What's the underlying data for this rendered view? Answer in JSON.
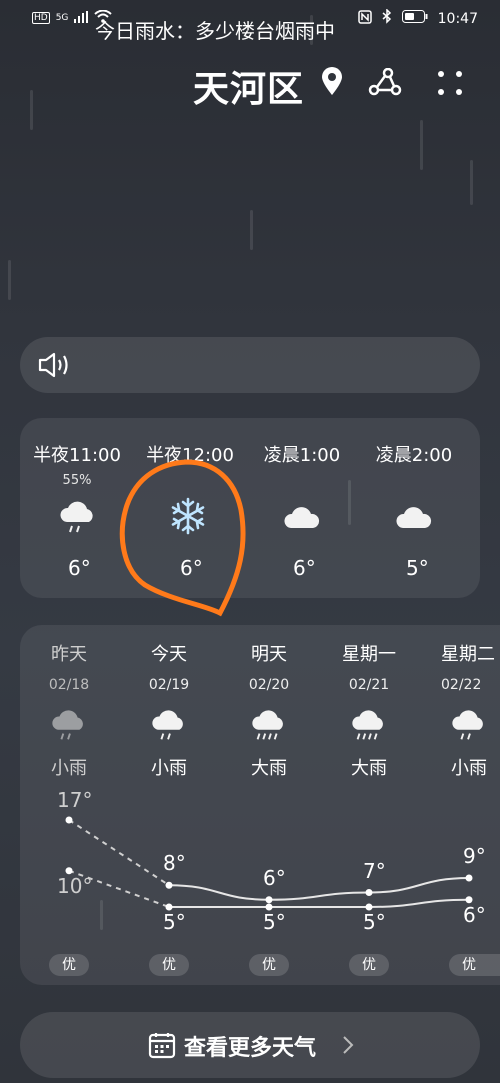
{
  "status_bar": {
    "left_badges": [
      "HD",
      "5G"
    ],
    "time": "10:47",
    "right_icons": [
      "nfc-icon",
      "bluetooth-icon",
      "battery-icon"
    ]
  },
  "header": {
    "city": "天河区",
    "icons": [
      "location-pin-icon",
      "share-icon",
      "more-icon"
    ]
  },
  "notice": {
    "icon": "speaker-icon",
    "text": "今日雨水：多少楼台烟雨中"
  },
  "hourly": [
    {
      "time": "半夜11:00",
      "precip": "55%",
      "icon": "rain-cloud-icon",
      "temp": "6°"
    },
    {
      "time": "半夜12:00",
      "precip": "",
      "icon": "snowflake-icon",
      "temp": "6°"
    },
    {
      "time": "凌晨1:00",
      "precip": "",
      "icon": "cloud-icon",
      "temp": "6°"
    },
    {
      "time": "凌晨2:00",
      "precip": "",
      "icon": "cloud-icon",
      "temp": "5°"
    }
  ],
  "daily": [
    {
      "name": "昨天",
      "date": "02/18",
      "icon": "rain-cloud-icon",
      "cond": "小雨",
      "high": "17°",
      "low": "10°",
      "aqi": "优"
    },
    {
      "name": "今天",
      "date": "02/19",
      "icon": "rain-cloud-icon",
      "cond": "小雨",
      "high": "8°",
      "low": "5°",
      "aqi": "优"
    },
    {
      "name": "明天",
      "date": "02/20",
      "icon": "heavy-rain-icon",
      "cond": "大雨",
      "high": "6°",
      "low": "5°",
      "aqi": "优"
    },
    {
      "name": "星期一",
      "date": "02/21",
      "icon": "heavy-rain-icon",
      "cond": "大雨",
      "high": "7°",
      "low": "5°",
      "aqi": "优"
    },
    {
      "name": "星期二",
      "date": "02/22",
      "icon": "rain-cloud-icon",
      "cond": "小雨",
      "high": "9°",
      "low": "6°",
      "aqi": "优"
    }
  ],
  "daily_values": {
    "high": [
      17,
      8,
      6,
      7,
      9
    ],
    "low": [
      10,
      5,
      5,
      5,
      6
    ]
  },
  "more_button": {
    "icon": "calendar-icon",
    "label": "查看更多天气"
  },
  "colors": {
    "annotation": "#ff7a1a",
    "background": "#30343b"
  }
}
